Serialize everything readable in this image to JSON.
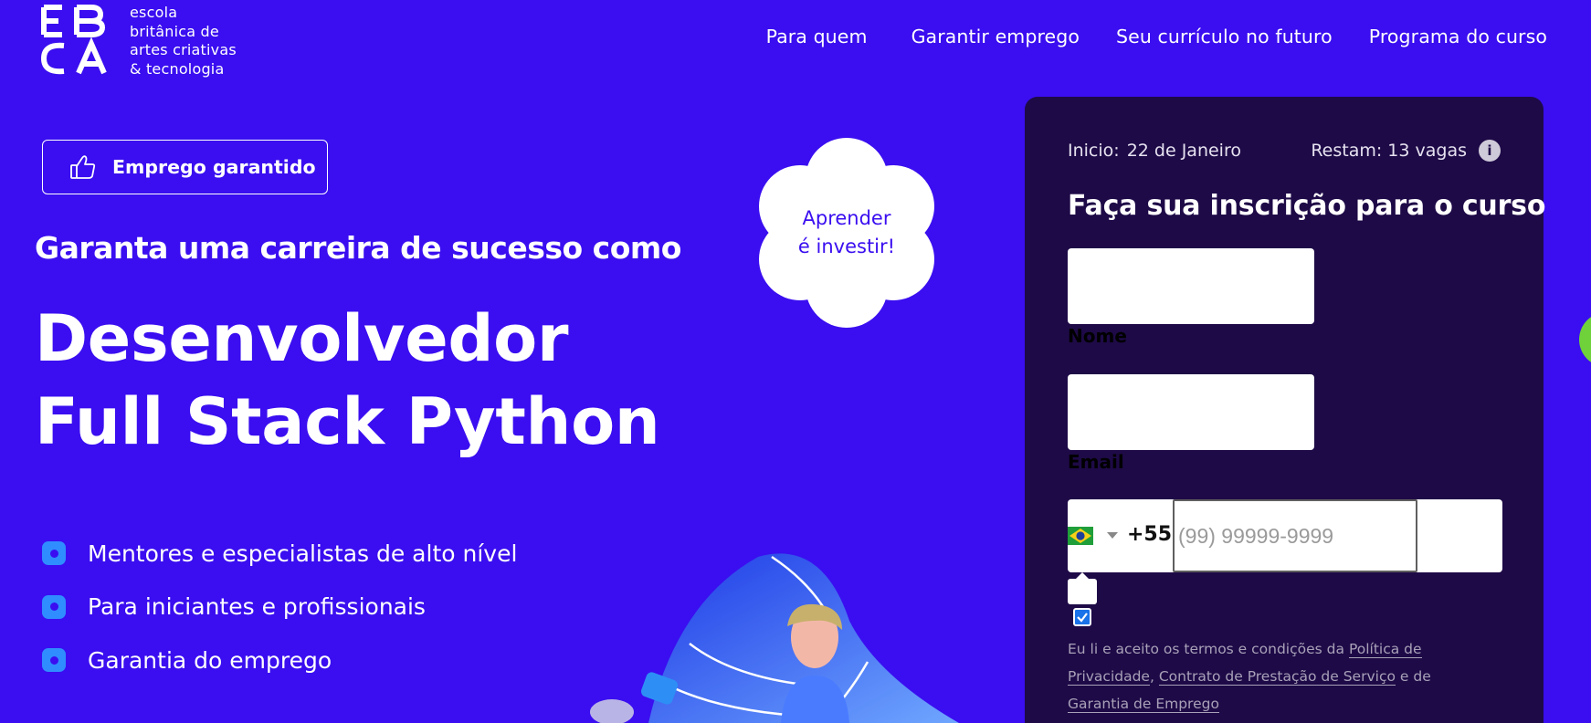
{
  "header": {
    "logo_lines": [
      "escola",
      "britânica de",
      "artes criativas",
      "& tecnologia"
    ],
    "logo_mark_letters": "EBAC",
    "nav": [
      "Para quem",
      "Garantir emprego",
      "Seu currículo no futuro",
      "Programa do curso"
    ]
  },
  "hero": {
    "badge_label": "Emprego garantido",
    "subtitle": "Garanta uma carreira de sucesso como",
    "headline_line1": "Desenvolvedor",
    "headline_line2": "Full Stack Python",
    "bullets": [
      "Mentores e especialistas de alto nível",
      "Para iniciantes e profissionais",
      "Garantia do emprego"
    ],
    "cloud_line1": "Aprender",
    "cloud_line2": "é investir!"
  },
  "form": {
    "start_label": "Inicio:",
    "start_date": "22 de Janeiro",
    "seats_text": "Restam: 13 vagas",
    "info_icon": "i",
    "title": "Faça sua inscrição para o curso",
    "name_label": "Nome",
    "email_label": "Email",
    "dial_code": "+55",
    "phone_placeholder": "(99) 99999-9999",
    "terms_prefix": "Eu li e aceito os termos e condições da ",
    "terms_link1": "Política de Privacidade",
    "terms_sep": ", ",
    "terms_link2": "Contrato de Prestação de Serviço",
    "terms_mid": " e de ",
    "terms_link3": "Garantia de Emprego",
    "checkbox_checked": true
  },
  "colors": {
    "background": "#3a0ef0",
    "panel": "#1e0a47",
    "bullet": "#2f8dff",
    "side_accent": "#6fd23a"
  },
  "icons": [
    "thumbs-up-icon",
    "info-icon",
    "brazil-flag-icon",
    "dropdown-caret-icon"
  ]
}
